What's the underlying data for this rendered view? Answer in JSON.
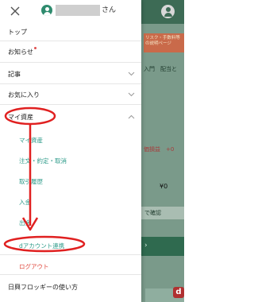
{
  "header": {
    "user_suffix": "さん"
  },
  "background": {
    "banner_text": "リスク・手数料等\nの説明ページ",
    "tabs_text": "入門　配当と",
    "loss_text": "価損益　+0",
    "amount_text": "¥0",
    "confirm_text": "で確認"
  },
  "menu": {
    "top": "トップ",
    "news": "お知らせ",
    "articles": "記事",
    "favorites": "お気に入り",
    "my_assets": "マイ資産",
    "sub_items": {
      "my_assets": "マイ資産",
      "orders": "注文・約定・取消",
      "history": "取引履歴",
      "deposit": "入金",
      "withdraw": "出金",
      "d_account": "dアカウント連携"
    },
    "logout": "ログアウト",
    "how_to_use": "日興フロッギーの使い方"
  },
  "colors": {
    "accent_teal": "#2e9b8a",
    "logout_red": "#e0483d",
    "annotation_red": "#e02020",
    "app_green": "#3d6b55"
  },
  "icons": {
    "close": "close-icon",
    "avatar": "user-avatar-icon",
    "chevron_down": "chevron-down-icon",
    "chevron_up": "chevron-up-icon"
  }
}
